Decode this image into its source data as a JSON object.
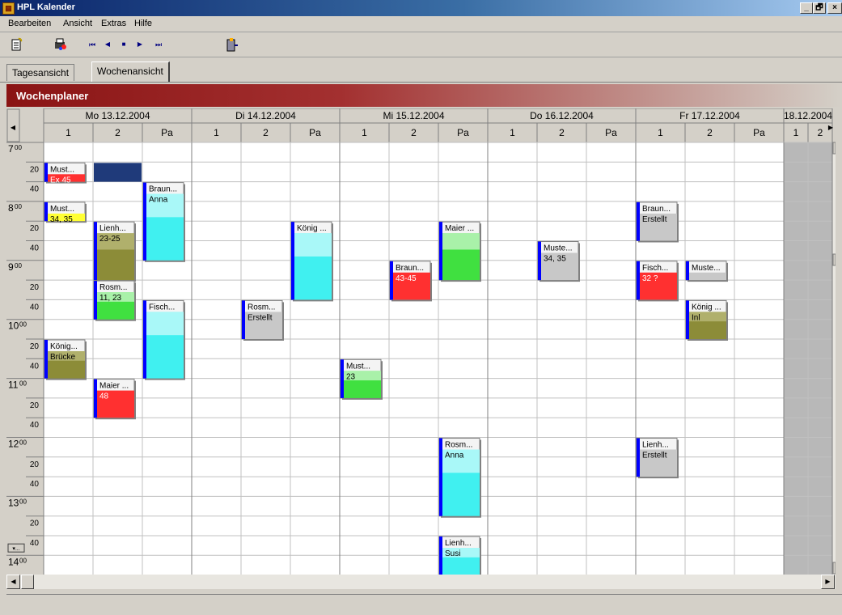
{
  "window": {
    "title": "HPL Kalender",
    "min": "_",
    "max": "🗗",
    "close": "×"
  },
  "menu": [
    "Bearbeiten",
    "Ansicht",
    "Extras",
    "Hilfe"
  ],
  "toolbar": {
    "first": "⏮",
    "prev": "◀",
    "stop": "■",
    "next": "▶",
    "last": "⏭"
  },
  "tabs": [
    "Tagesansicht",
    "Wochenansicht"
  ],
  "active_tab": 1,
  "header_title": "Wochenplaner",
  "days": [
    {
      "label": "Mo 13.12.2004",
      "cols": [
        "1",
        "2",
        "Pa"
      ]
    },
    {
      "label": "Di 14.12.2004",
      "cols": [
        "1",
        "2",
        "Pa"
      ]
    },
    {
      "label": "Mi 15.12.2004",
      "cols": [
        "1",
        "2",
        "Pa"
      ]
    },
    {
      "label": "Do 16.12.2004",
      "cols": [
        "1",
        "2",
        "Pa"
      ]
    },
    {
      "label": "Fr 17.12.2004",
      "cols": [
        "1",
        "2",
        "Pa"
      ]
    },
    {
      "label": "18.12.2004",
      "cols": [
        "1",
        "2"
      ],
      "weekend": true
    }
  ],
  "time_rows": [
    {
      "hour": "7",
      "min": "00"
    },
    {
      "min": "20"
    },
    {
      "min": "40"
    },
    {
      "hour": "8",
      "min": "00"
    },
    {
      "min": "20"
    },
    {
      "min": "40"
    },
    {
      "hour": "9",
      "min": "00"
    },
    {
      "min": "20"
    },
    {
      "min": "40"
    },
    {
      "hour": "10",
      "min": "00"
    },
    {
      "min": "20"
    },
    {
      "min": "40"
    },
    {
      "hour": "11",
      "min": "00"
    },
    {
      "min": "20"
    },
    {
      "min": "40"
    },
    {
      "hour": "12",
      "min": "00"
    },
    {
      "min": "20"
    },
    {
      "min": "40"
    },
    {
      "hour": "13",
      "min": "00"
    },
    {
      "min": "20"
    },
    {
      "min": "40"
    },
    {
      "hour": "14",
      "min": "00"
    }
  ],
  "colors": {
    "red": "#ff3030",
    "yellow": "#ffff33",
    "olive": "#8c8c38",
    "cyan": "#40f0f0",
    "green": "#40e040",
    "gray": "#c8c8c8",
    "selected": "#1f3a7a",
    "accent": "#0000ff"
  },
  "appointments": [
    {
      "day": 0,
      "col": 0,
      "start": 1,
      "span": 1,
      "name": "Must...",
      "info": "Ex 45",
      "color": "red"
    },
    {
      "day": 0,
      "col": 0,
      "start": 3,
      "span": 1,
      "name": "Must...",
      "info": "34, 35",
      "color": "yellow"
    },
    {
      "day": 0,
      "col": 0,
      "start": 10,
      "span": 2,
      "name": "König...",
      "info": "Brücke",
      "color": "olive"
    },
    {
      "day": 0,
      "col": 1,
      "start": 4,
      "span": 3,
      "name": "Lienh...",
      "info": "23-25",
      "color": "olive"
    },
    {
      "day": 0,
      "col": 1,
      "start": 7,
      "span": 2,
      "name": "Rosm...",
      "info": "11, 23",
      "color": "green"
    },
    {
      "day": 0,
      "col": 1,
      "start": 12,
      "span": 2,
      "name": "Maier ...",
      "info": "48",
      "color": "red"
    },
    {
      "day": 0,
      "col": 2,
      "start": 2,
      "span": 4,
      "name": "Braun...",
      "info": "Anna",
      "color": "cyan"
    },
    {
      "day": 0,
      "col": 2,
      "start": 8,
      "span": 4,
      "name": "Fisch...",
      "info": "",
      "color": "cyan"
    },
    {
      "day": 1,
      "col": 1,
      "start": 8,
      "span": 2,
      "name": "Rosm...",
      "info": "Erstellt",
      "color": "gray"
    },
    {
      "day": 1,
      "col": 2,
      "start": 4,
      "span": 4,
      "name": "König ...",
      "info": "",
      "color": "cyan"
    },
    {
      "day": 2,
      "col": 0,
      "start": 11,
      "span": 2,
      "name": "Must...",
      "info": "23",
      "color": "green"
    },
    {
      "day": 2,
      "col": 1,
      "start": 6,
      "span": 2,
      "name": "Braun...",
      "info": "43-45",
      "color": "red"
    },
    {
      "day": 2,
      "col": 2,
      "start": 4,
      "span": 3,
      "name": "Maier ...",
      "info": "",
      "color": "green"
    },
    {
      "day": 2,
      "col": 2,
      "start": 15,
      "span": 4,
      "name": "Rosm...",
      "info": "Anna",
      "color": "cyan"
    },
    {
      "day": 2,
      "col": 2,
      "start": 20,
      "span": 2,
      "name": "Lienh...",
      "info": "Susi",
      "color": "cyan"
    },
    {
      "day": 3,
      "col": 1,
      "start": 5,
      "span": 2,
      "name": "Muste...",
      "info": "34, 35",
      "color": "gray"
    },
    {
      "day": 4,
      "col": 0,
      "start": 3,
      "span": 2,
      "name": "Braun...",
      "info": "Erstellt",
      "color": "gray"
    },
    {
      "day": 4,
      "col": 0,
      "start": 6,
      "span": 2,
      "name": "Fisch...",
      "info": "32 ?",
      "color": "red"
    },
    {
      "day": 4,
      "col": 0,
      "start": 15,
      "span": 2,
      "name": "Lienh...",
      "info": "Erstellt",
      "color": "gray"
    },
    {
      "day": 4,
      "col": 1,
      "start": 6,
      "span": 1,
      "name": "Muste...",
      "info": "",
      "color": "gray"
    },
    {
      "day": 4,
      "col": 1,
      "start": 8,
      "span": 2,
      "name": "König ...",
      "info": "Inl",
      "color": "olive"
    }
  ],
  "selected_cell": {
    "day": 0,
    "col": 1,
    "start": 1,
    "span": 1
  },
  "nav": {
    "left": "◀",
    "right": "▶",
    "up": "▲",
    "down": "▼",
    "more": "▾..."
  }
}
